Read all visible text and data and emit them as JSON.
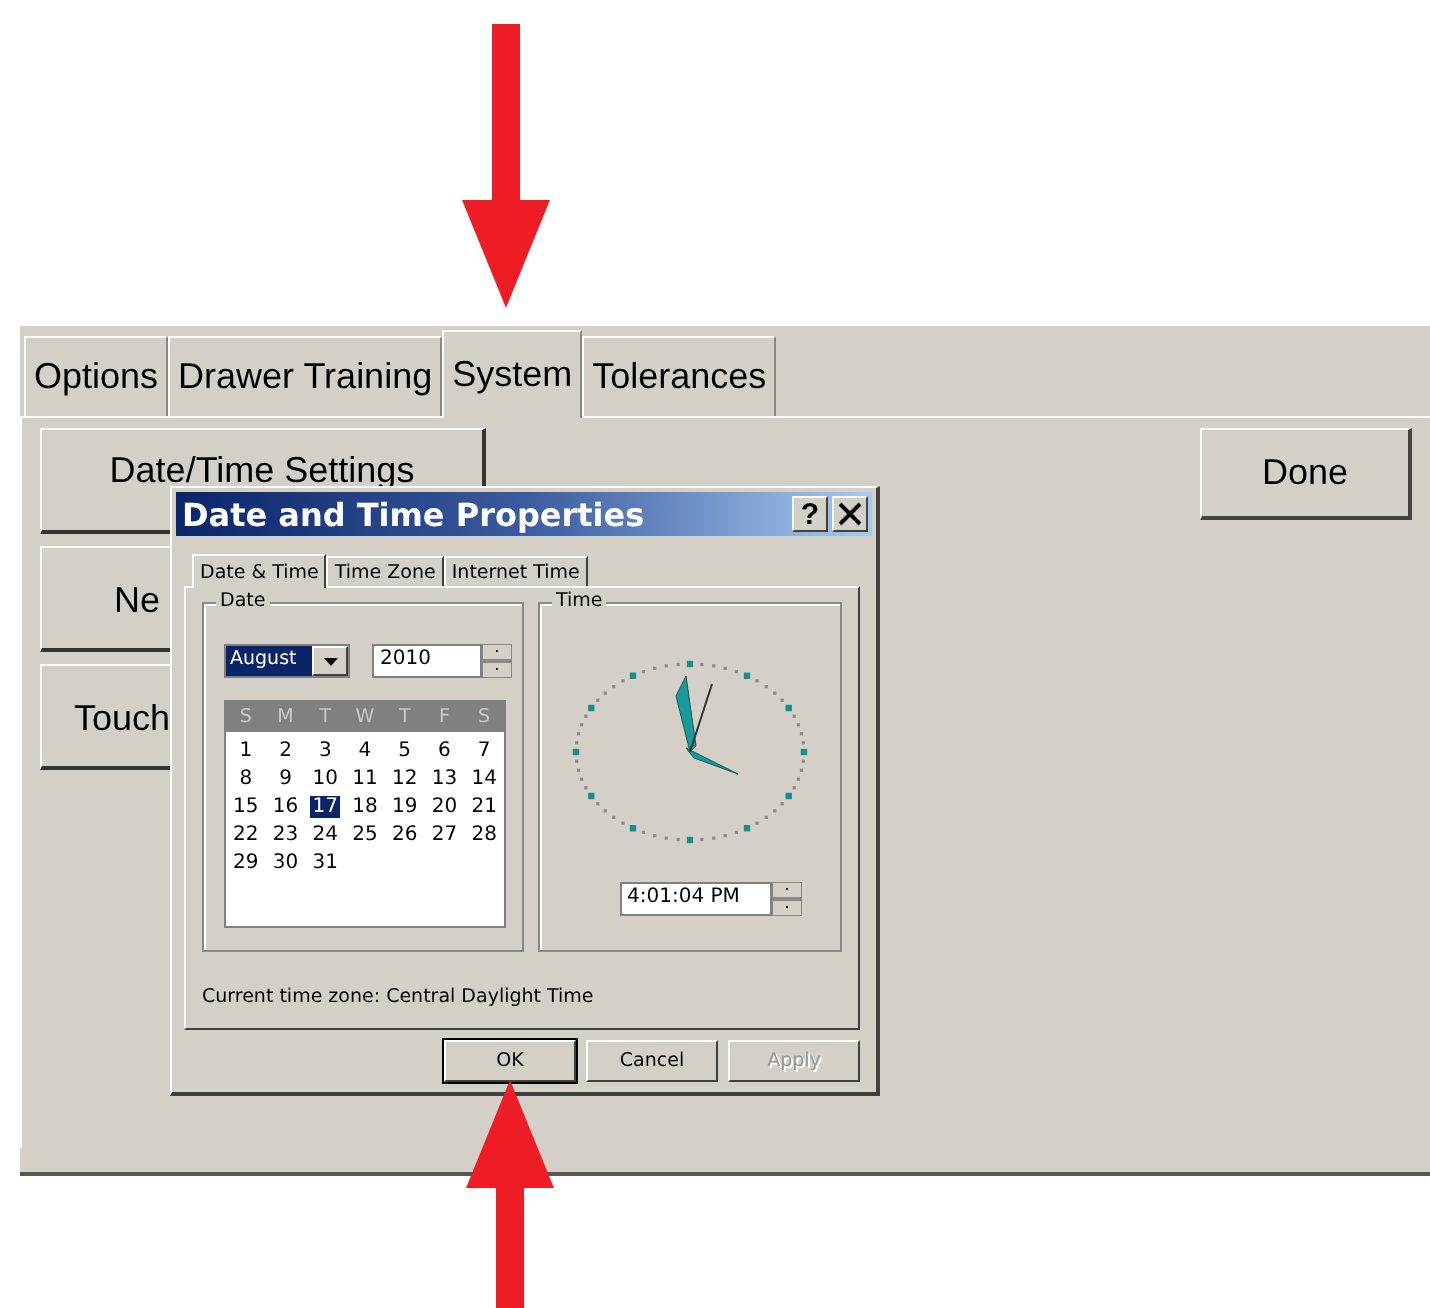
{
  "tabs": [
    {
      "label": "Options",
      "selected": false
    },
    {
      "label": "Drawer Training",
      "selected": false
    },
    {
      "label": "System",
      "selected": true
    },
    {
      "label": "Tolerances",
      "selected": false
    }
  ],
  "buttons": [
    {
      "label": "Date/Time Settings"
    },
    {
      "label": "Ne"
    },
    {
      "label": "Touch"
    }
  ],
  "done_button": "Done",
  "dialog": {
    "title": "Date and Time Properties",
    "help_button": "?",
    "tabs": [
      {
        "label": "Date & Time",
        "selected": true
      },
      {
        "label": "Time Zone",
        "selected": false
      },
      {
        "label": "Internet Time",
        "selected": false
      }
    ],
    "date_group": {
      "label": "Date",
      "month": "August",
      "year": "2010",
      "weekdays": [
        "S",
        "M",
        "T",
        "W",
        "T",
        "F",
        "S"
      ],
      "days": [
        {
          "day": "1",
          "selected": false
        },
        {
          "day": "2",
          "selected": false
        },
        {
          "day": "3",
          "selected": false
        },
        {
          "day": "4",
          "selected": false
        },
        {
          "day": "5",
          "selected": false
        },
        {
          "day": "6",
          "selected": false
        },
        {
          "day": "7",
          "selected": false
        },
        {
          "day": "8",
          "selected": false
        },
        {
          "day": "9",
          "selected": false
        },
        {
          "day": "10",
          "selected": false
        },
        {
          "day": "11",
          "selected": false
        },
        {
          "day": "12",
          "selected": false
        },
        {
          "day": "13",
          "selected": false
        },
        {
          "day": "14",
          "selected": false
        },
        {
          "day": "15",
          "selected": false
        },
        {
          "day": "16",
          "selected": false
        },
        {
          "day": "17",
          "selected": true
        },
        {
          "day": "18",
          "selected": false
        },
        {
          "day": "19",
          "selected": false
        },
        {
          "day": "20",
          "selected": false
        },
        {
          "day": "21",
          "selected": false
        },
        {
          "day": "22",
          "selected": false
        },
        {
          "day": "23",
          "selected": false
        },
        {
          "day": "24",
          "selected": false
        },
        {
          "day": "25",
          "selected": false
        },
        {
          "day": "26",
          "selected": false
        },
        {
          "day": "27",
          "selected": false
        },
        {
          "day": "28",
          "selected": false
        },
        {
          "day": "29",
          "selected": false
        },
        {
          "day": "30",
          "selected": false
        },
        {
          "day": "31",
          "selected": false
        }
      ]
    },
    "time_group": {
      "label": "Time",
      "time": "4:01:04 PM"
    },
    "timezone": "Current time zone:  Central Daylight Time",
    "buttons": [
      {
        "label": "OK",
        "disabled": false
      },
      {
        "label": "Cancel",
        "disabled": false
      },
      {
        "label": "Apply",
        "disabled": true
      }
    ]
  }
}
